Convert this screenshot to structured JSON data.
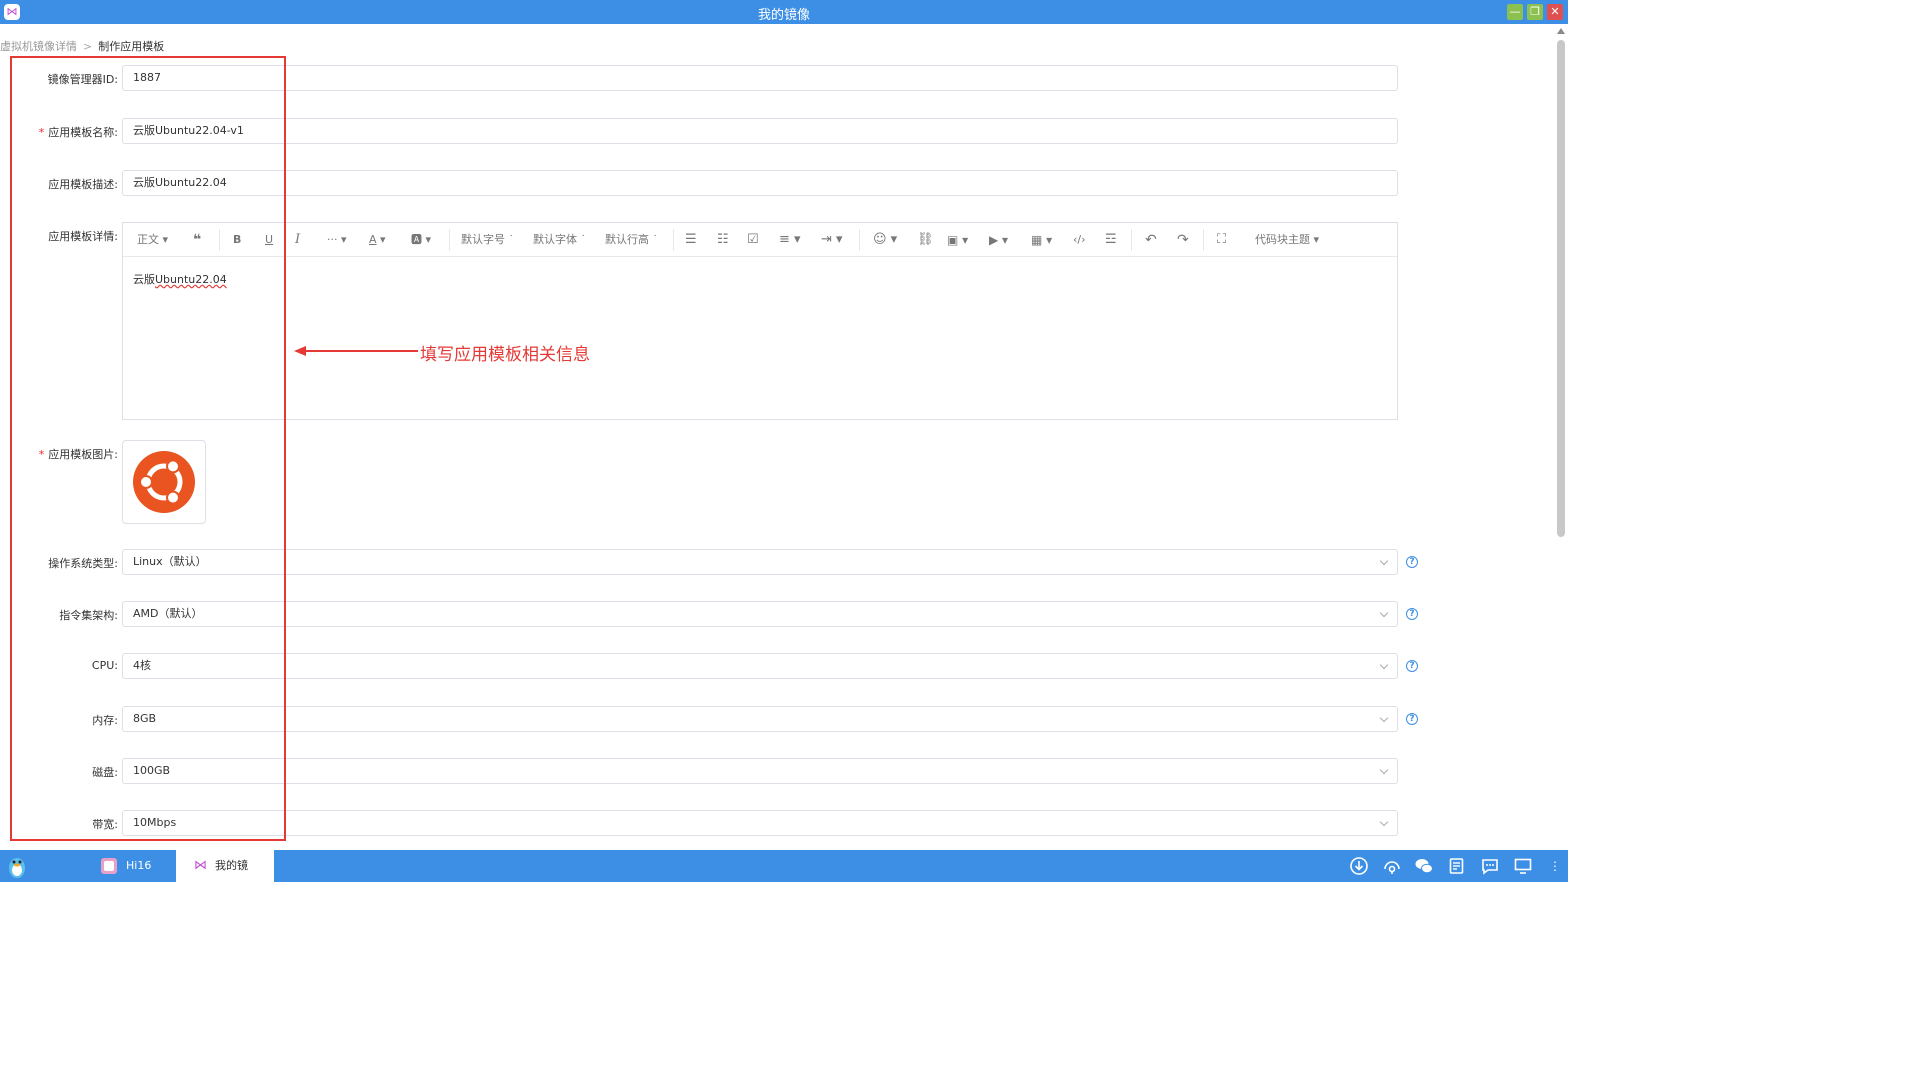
{
  "window": {
    "title": "我的镜像"
  },
  "breadcrumb": {
    "parent": "虚拟机镜像详情",
    "separator": ">",
    "current": "制作应用模板"
  },
  "form": {
    "manager_id": {
      "label": "镜像管理器ID:",
      "value": "1887"
    },
    "template_name": {
      "label": "应用模板名称:",
      "required_mark": "*",
      "value": "云版Ubuntu22.04-v1"
    },
    "template_desc": {
      "label": "应用模板描述:",
      "value": "云版Ubuntu22.04"
    },
    "template_detail": {
      "label": "应用模板详情:",
      "content": "云版",
      "content_spellcheck": "Ubuntu22.04",
      "toolbar": {
        "paragraph": "正文",
        "font_size": "默认字号",
        "font_family": "默认字体",
        "line_height": "默认行高",
        "code_theme": "代码块主题"
      }
    },
    "template_image": {
      "label": "应用模板图片:",
      "required_mark": "*",
      "image_icon": "ubuntu-logo-icon"
    },
    "os_type": {
      "label": "操作系统类型:",
      "value": "Linux（默认）"
    },
    "isa": {
      "label": "指令集架构:",
      "value": "AMD（默认）"
    },
    "cpu": {
      "label": "CPU:",
      "value": "4核"
    },
    "memory": {
      "label": "内存:",
      "value": "8GB"
    },
    "disk": {
      "label": "磁盘:",
      "value": "100GB"
    },
    "bandwidth": {
      "label": "带宽:",
      "value": "10Mbps"
    }
  },
  "annotation": {
    "text": "填写应用模板相关信息",
    "color": "#e53935"
  },
  "taskbar": {
    "tasks": [
      {
        "label": "Hi16",
        "icon": "hi16-app-icon",
        "active": false
      },
      {
        "label": "我的镜",
        "icon": "mirror-app-icon",
        "active": true
      }
    ],
    "tray_icons": [
      "download-icon",
      "headphones-icon",
      "wechat-icon",
      "notes-icon",
      "chat-icon",
      "monitor-icon",
      "more-icon"
    ]
  },
  "colors": {
    "titlebar": "#3d8fe6",
    "required": "#f5222d",
    "ubuntu": "#e95420",
    "help": "#3d8fe6"
  }
}
